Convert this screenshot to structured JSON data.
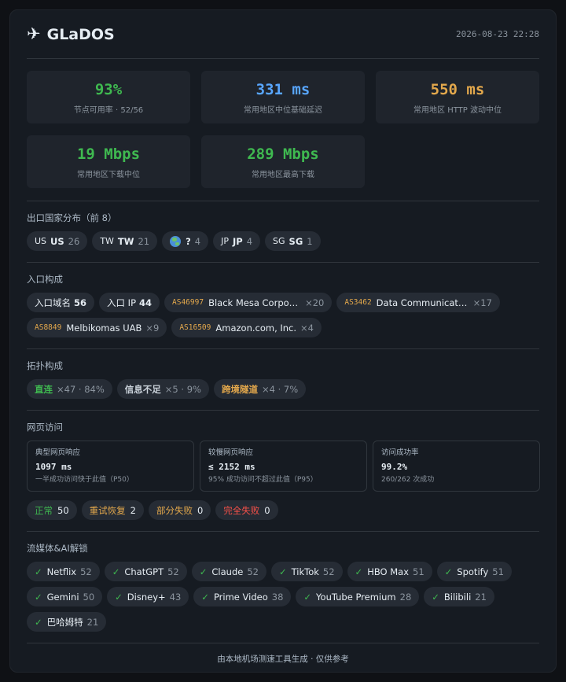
{
  "header": {
    "icon": "airplane-icon",
    "title": "GLaDOS",
    "timestamp": "2026-08-23 22:28"
  },
  "stats": [
    {
      "value": "93%",
      "label": "节点可用率 · 52/56",
      "color": "#3fb950"
    },
    {
      "value": "331 ms",
      "label": "常用地区中位基础延迟",
      "color": "#58a6ff"
    },
    {
      "value": "550 ms",
      "label": "常用地区 HTTP 波动中位",
      "color": "#e3a84c"
    },
    {
      "value": "19 Mbps",
      "label": "常用地区下载中位",
      "color": "#3fb950"
    },
    {
      "value": "289 Mbps",
      "label": "常用地区最高下载",
      "color": "#3fb950"
    }
  ],
  "countries": {
    "title": "出口国家分布（前 8）",
    "items": [
      {
        "flag": "US",
        "name": "US",
        "count": "26"
      },
      {
        "flag": "TW",
        "name": "TW",
        "count": "21"
      },
      {
        "flag": "",
        "name": "?",
        "count": "4"
      },
      {
        "flag": "JP",
        "name": "JP",
        "count": "4"
      },
      {
        "flag": "SG",
        "name": "SG",
        "count": "1"
      }
    ]
  },
  "entry": {
    "title": "入口构成",
    "domains_label": "入口域名",
    "domains_count": "56",
    "ip_label": "入口 IP",
    "ip_count": "44",
    "asns": [
      {
        "asn": "AS46997",
        "name": "Black Mesa Corporation",
        "count": "×20"
      },
      {
        "asn": "AS3462",
        "name": "Data Communication Business Group",
        "count": "×17"
      },
      {
        "asn": "AS8849",
        "name": "Melbikomas UAB",
        "count": "×9"
      },
      {
        "asn": "AS16509",
        "name": "Amazon.com, Inc.",
        "count": "×4"
      }
    ]
  },
  "topology": {
    "title": "拓扑构成",
    "items": [
      {
        "label": "直连",
        "detail": "×47 · 84%",
        "color": "#3fb950"
      },
      {
        "label": "信息不足",
        "detail": "×5 · 9%",
        "color": "#c9d1d9"
      },
      {
        "label": "跨境隧道",
        "detail": "×4 · 7%",
        "color": "#e3a84c"
      }
    ]
  },
  "web": {
    "title": "网页访问",
    "boxes": [
      {
        "label": "典型网页响应",
        "value": "1097 ms",
        "note": "一半成功访问快于此值（P50）"
      },
      {
        "label": "较慢网页响应",
        "value": "≤ 2152 ms",
        "note": "95% 成功访问不超过此值（P95）"
      },
      {
        "label": "访问成功率",
        "value": "99.2%",
        "note": "260/262 次成功"
      }
    ],
    "statuses": [
      {
        "label": "正常",
        "count": "50",
        "color": "#3fb950"
      },
      {
        "label": "重试恢复",
        "count": "2",
        "color": "#e3a84c"
      },
      {
        "label": "部分失败",
        "count": "0",
        "color": "#e3a84c"
      },
      {
        "label": "完全失败",
        "count": "0",
        "color": "#f85149"
      }
    ]
  },
  "streaming": {
    "title": "流媒体&AI解锁",
    "items": [
      {
        "name": "Netflix",
        "count": "52"
      },
      {
        "name": "ChatGPT",
        "count": "52"
      },
      {
        "name": "Claude",
        "count": "52"
      },
      {
        "name": "TikTok",
        "count": "52"
      },
      {
        "name": "HBO Max",
        "count": "51"
      },
      {
        "name": "Spotify",
        "count": "51"
      },
      {
        "name": "Gemini",
        "count": "50"
      },
      {
        "name": "Disney+",
        "count": "43"
      },
      {
        "name": "Prime Video",
        "count": "38"
      },
      {
        "name": "YouTube Premium",
        "count": "28"
      },
      {
        "name": "Bilibili",
        "count": "21"
      },
      {
        "name": "巴哈姆特",
        "count": "21"
      }
    ]
  },
  "footer": {
    "text": "由本地机场测速工具生成 · 仅供参考"
  }
}
